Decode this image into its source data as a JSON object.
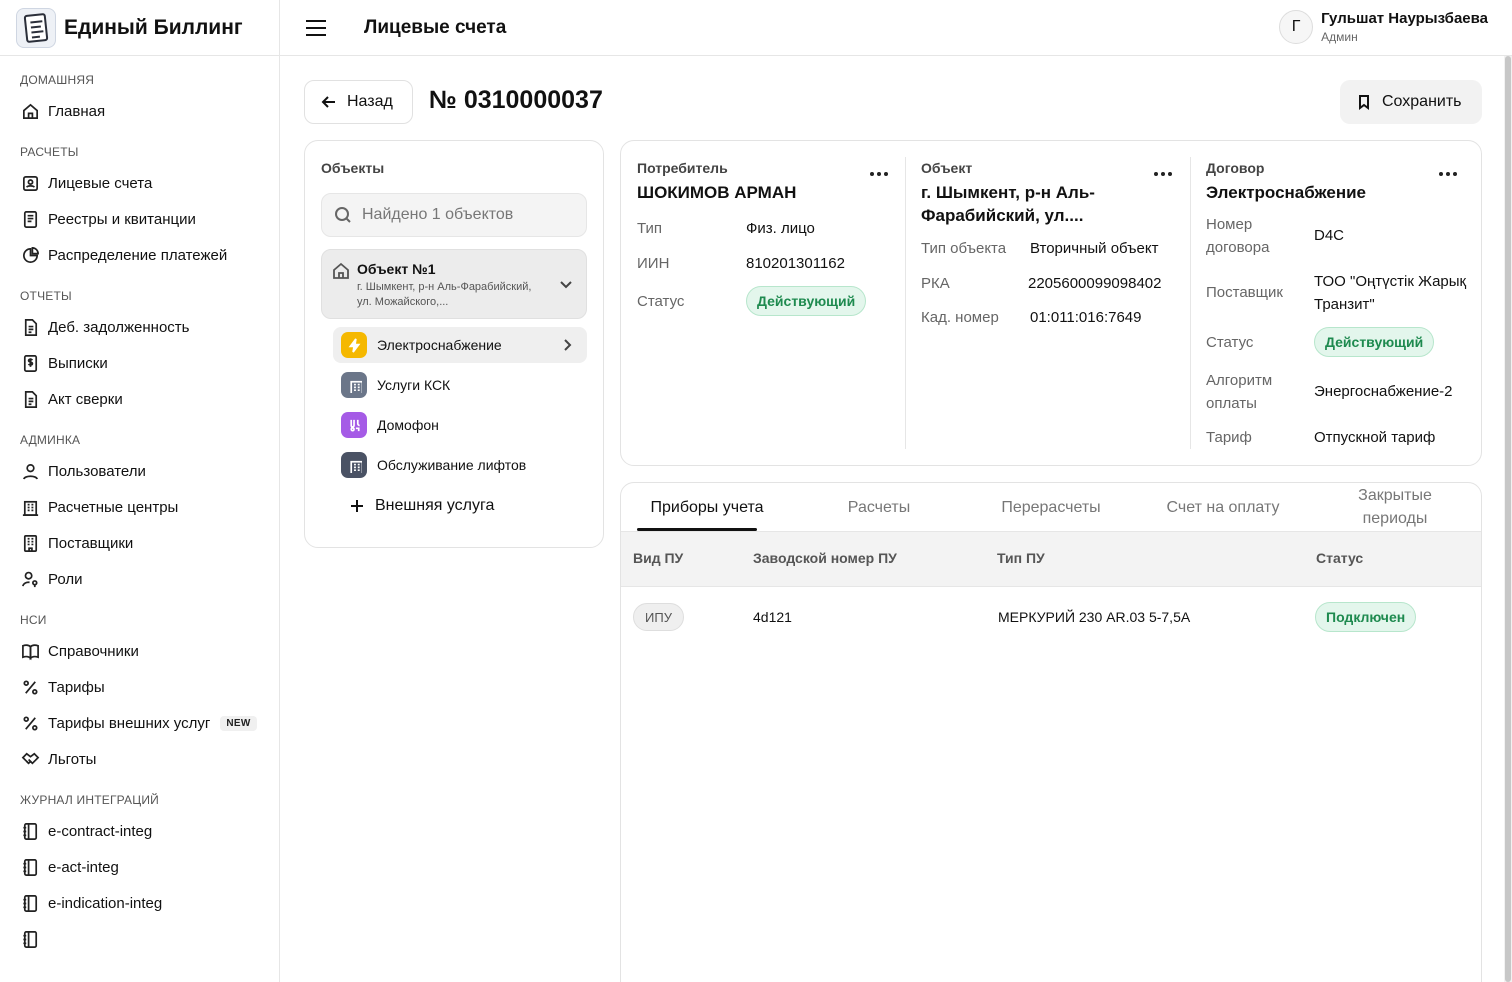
{
  "brand": {
    "title": "Единый Биллинг"
  },
  "header": {
    "title": "Лицевые счета"
  },
  "user": {
    "initial": "Г",
    "name": "Гульшат Наурызбаева",
    "role": "Админ"
  },
  "sidebar": {
    "sections": [
      {
        "title": "ДОМАШНЯЯ",
        "items": [
          {
            "label": "Главная",
            "icon": "home-icon"
          }
        ]
      },
      {
        "title": "РАСЧЕТЫ",
        "items": [
          {
            "label": "Лицевые счета",
            "icon": "account-card-icon"
          },
          {
            "label": "Реестры и квитанции",
            "icon": "receipt-icon"
          },
          {
            "label": "Распределение платежей",
            "icon": "pie-chart-icon"
          }
        ]
      },
      {
        "title": "ОТЧЕТЫ",
        "items": [
          {
            "label": "Деб. задолженность",
            "icon": "document-icon"
          },
          {
            "label": "Выписки",
            "icon": "dollar-doc-icon"
          },
          {
            "label": "Акт сверки",
            "icon": "document-icon"
          }
        ]
      },
      {
        "title": "АДМИНКА",
        "items": [
          {
            "label": "Пользователи",
            "icon": "user-icon"
          },
          {
            "label": "Расчетные центры",
            "icon": "building-icon"
          },
          {
            "label": "Поставщики",
            "icon": "office-icon"
          },
          {
            "label": "Роли",
            "icon": "user-key-icon"
          }
        ]
      },
      {
        "title": "НСИ",
        "items": [
          {
            "label": "Справочники",
            "icon": "book-icon"
          },
          {
            "label": "Тарифы",
            "icon": "percent-icon"
          },
          {
            "label": "Тарифы внешних услуг",
            "icon": "percent-icon",
            "badge": "NEW"
          },
          {
            "label": "Льготы",
            "icon": "handshake-icon"
          }
        ]
      },
      {
        "title": "ЖУРНАЛ ИНТЕГРАЦИЙ",
        "items": [
          {
            "label": "e-contract-integ",
            "icon": "notebook-icon"
          },
          {
            "label": "e-act-integ",
            "icon": "notebook-icon"
          },
          {
            "label": "e-indication-integ",
            "icon": "notebook-icon"
          },
          {
            "label": "",
            "icon": "notebook-icon"
          }
        ]
      }
    ]
  },
  "page": {
    "back_label": "Назад",
    "account_number": "№ 0310000037",
    "save_label": "Сохранить"
  },
  "objects": {
    "title": "Объекты",
    "search_placeholder": "Найдено 1 объектов",
    "object": {
      "name": "Объект №1",
      "address": "г. Шымкент, р-н Аль-Фарабийский, ул. Можайского,..."
    },
    "services": [
      {
        "label": "Электроснабжение",
        "icon": "lightning-icon",
        "color": "#f5b800",
        "active": true
      },
      {
        "label": "Услуги КСК",
        "icon": "building-icon",
        "color": "#6b7689"
      },
      {
        "label": "Домофон",
        "icon": "intercom-icon",
        "color": "#a55be6"
      },
      {
        "label": "Обслуживание лифтов",
        "icon": "building-icon",
        "color": "#4a5264"
      }
    ],
    "add_external": "Внешняя услуга"
  },
  "consumer": {
    "label": "Потребитель",
    "name": "ШОКИМОВ АРМАН",
    "type_k": "Тип",
    "type_v": "Физ. лицо",
    "iin_k": "ИИН",
    "iin_v": "810201301162",
    "status_k": "Статус",
    "status_v": "Действующий"
  },
  "object_info": {
    "label": "Объект",
    "title": "г. Шымкент, р-н Аль-Фарабийский, ул....",
    "type_k": "Тип объекта",
    "type_v": "Вторичный объект",
    "rka_k": "РКА",
    "rka_v": "2205600099098402",
    "cad_k": "Кад. номер",
    "cad_v": "01:011:016:7649"
  },
  "contract": {
    "label": "Договор",
    "title": "Электроснабжение",
    "number_k": "Номер договора",
    "number_v": "D4C",
    "supplier_k": "Поставщик",
    "supplier_v": "ТОО \"Оңтүстік Жарық Транзит\"",
    "status_k": "Статус",
    "status_v": "Действующий",
    "algo_k": "Алгоритм оплаты",
    "algo_v": "Энергоснабжение-2",
    "tariff_k": "Тариф",
    "tariff_v": "Отпускной тариф"
  },
  "tabs": [
    {
      "label": "Приборы учета",
      "active": true
    },
    {
      "label": "Расчеты"
    },
    {
      "label": "Перерасчеты"
    },
    {
      "label": "Счет на оплату"
    },
    {
      "label": "Закрытые периоды"
    }
  ],
  "meters": {
    "columns": [
      "Вид ПУ",
      "Заводской номер ПУ",
      "Тип ПУ",
      "Статус"
    ],
    "rows": [
      {
        "kind": "ИПУ",
        "serial": "4d121",
        "type": "МЕРКУРИЙ 230 AR.03 5-7,5А",
        "status": "Подключен"
      }
    ]
  }
}
